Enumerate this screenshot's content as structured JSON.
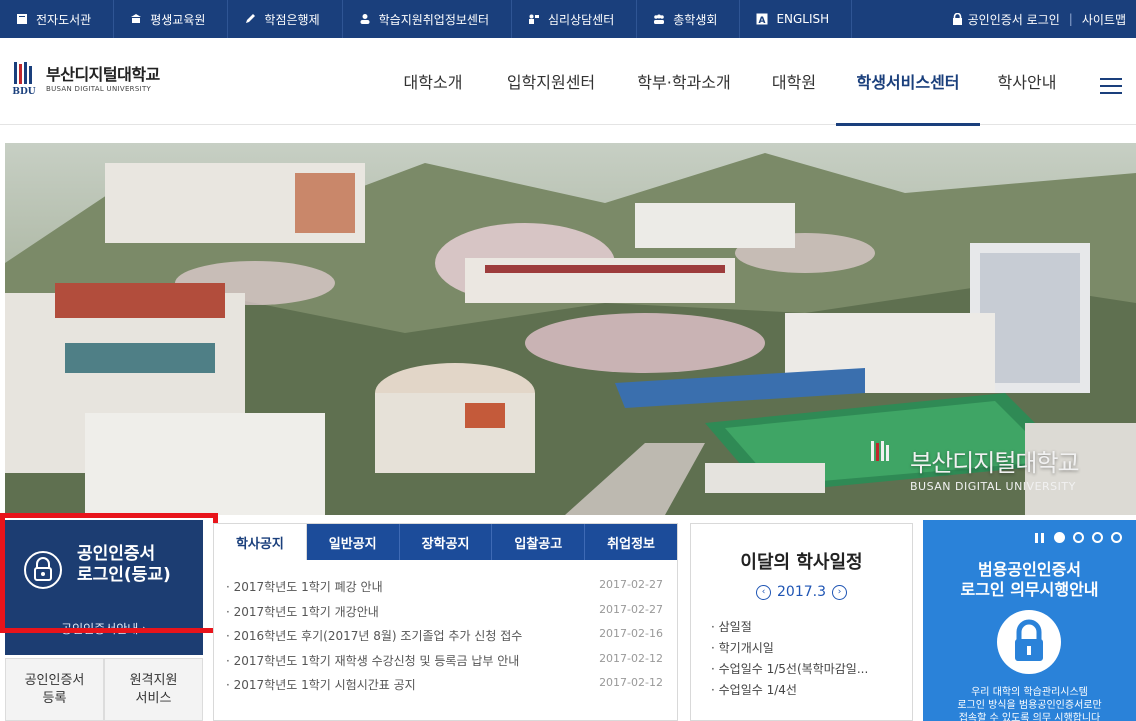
{
  "topbar": {
    "items": [
      {
        "label": "전자도서관",
        "icon": "book-icon"
      },
      {
        "label": "평생교육원",
        "icon": "building-icon"
      },
      {
        "label": "학점은행제",
        "icon": "pencil-icon"
      },
      {
        "label": "학습지원취업정보센터",
        "icon": "person-icon"
      },
      {
        "label": "심리상담센터",
        "icon": "counsel-icon"
      },
      {
        "label": "총학생회",
        "icon": "group-icon"
      },
      {
        "label": "ENGLISH",
        "icon": "letter-a-icon"
      }
    ],
    "cert_login": "공인인증서 로그인",
    "sitemap": "사이트맵"
  },
  "logo": {
    "ko": "부산디지털대학교",
    "en": "BUSAN DIGITAL UNIVERSITY",
    "mark": "BDU"
  },
  "nav": {
    "items": [
      "대학소개",
      "입학지원센터",
      "학부·학과소개",
      "대학원",
      "학생서비스센터",
      "학사안내"
    ],
    "active": "학생서비스센터"
  },
  "hero": {
    "logo_ko": "부산디지털대학교",
    "logo_en": "BUSAN DIGITAL UNIVERSITY"
  },
  "cert_panel": {
    "title_line1": "공인인증서",
    "title_line2": "로그인(등교)",
    "guide": "공인인증서안내 ›"
  },
  "sub_buttons": [
    {
      "line1": "공인인증서",
      "line2": "등록"
    },
    {
      "line1": "원격지원",
      "line2": "서비스"
    }
  ],
  "notice": {
    "tabs": [
      "학사공지",
      "일반공지",
      "장학공지",
      "입찰공고",
      "취업정보"
    ],
    "active_tab": "학사공지",
    "items": [
      {
        "title": "· 2017학년도 1학기 폐강 안내",
        "date": "2017-02-27"
      },
      {
        "title": "· 2017학년도 1학기 개강안내",
        "date": "2017-02-27"
      },
      {
        "title": "· 2016학년도 후기(2017년 8월) 조기졸업 추가 신청 접수",
        "date": "2017-02-16"
      },
      {
        "title": "· 2017학년도 1학기 재학생 수강신청 및 등록금 납부 안내",
        "date": "2017-02-12"
      },
      {
        "title": "· 2017학년도 1학기 시험시간표 공지",
        "date": "2017-02-12"
      }
    ]
  },
  "calendar": {
    "title": "이달의 학사일정",
    "month": "2017.3",
    "prev": "‹",
    "next": "›",
    "items": [
      "· 삼일절",
      "· 학기개시일",
      "· 수업일수 1/5선(복학마감일...",
      "· 수업일수 1/4선"
    ]
  },
  "banner": {
    "title_line1": "범용공인인증서",
    "title_line2": "로그인 의무시행안내",
    "desc_line1": "우리 대학의 학습관리시스템",
    "desc_line2": "로그인 방식을 범용공인인증서로만",
    "desc_line3": "접속할 수 있도록 의무 시행합니다",
    "active_slide": 1,
    "slide_count": 4
  },
  "colors": {
    "brand_navy": "#1a3f7c",
    "tab_blue": "#1c4c9a",
    "banner_blue": "#2a82d9",
    "highlight_red": "#e8141b"
  }
}
